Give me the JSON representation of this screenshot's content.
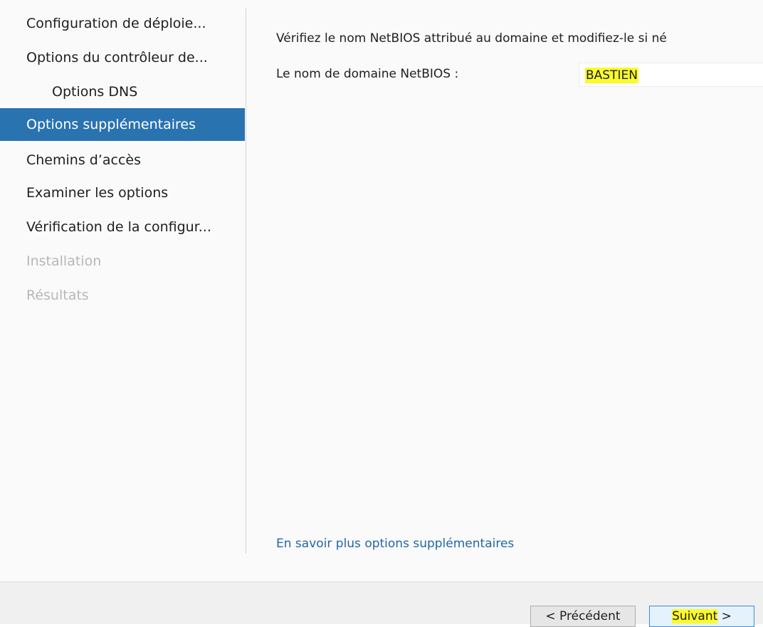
{
  "sidebar": {
    "items": [
      {
        "label": "Configuration de déploie...",
        "state": "normal"
      },
      {
        "label": "Options du contrôleur de...",
        "state": "normal"
      },
      {
        "label": "Options DNS",
        "state": "sub"
      },
      {
        "label": "Options supplémentaires",
        "state": "active"
      },
      {
        "label": "Chemins d’accès",
        "state": "normal"
      },
      {
        "label": "Examiner les options",
        "state": "normal"
      },
      {
        "label": "Vérification de la configur...",
        "state": "normal"
      },
      {
        "label": "Installation",
        "state": "disabled"
      },
      {
        "label": "Résultats",
        "state": "disabled"
      }
    ]
  },
  "main": {
    "instruction": "Vérifiez le nom NetBIOS attribué au domaine et modifiez-le si né",
    "netbios_label": "Le nom de domaine NetBIOS :",
    "netbios_value": "BASTIEN",
    "help_link": "En savoir plus options supplémentaires"
  },
  "footer": {
    "prev_label": "< Précédent",
    "next_label_highlight": "Suivant",
    "next_label_rest": " >"
  },
  "colors": {
    "accent": "#2a73b1",
    "highlight": "#fbfb2a",
    "link": "#2366a8",
    "disabled_text": "#b7b7b7"
  }
}
